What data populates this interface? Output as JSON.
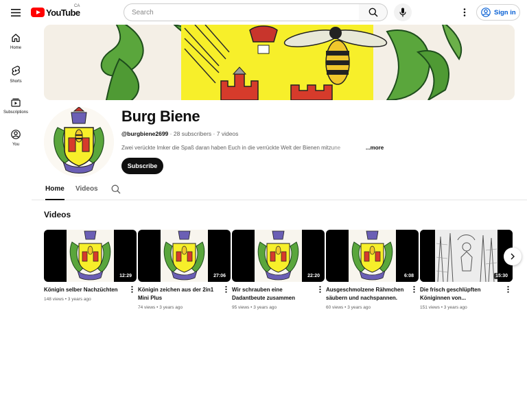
{
  "header": {
    "logo_text": "YouTube",
    "country_code": "CA",
    "search_placeholder": "Search",
    "sign_in_label": "Sign in"
  },
  "sidebar": {
    "items": [
      {
        "label": "Home",
        "icon": "home-icon"
      },
      {
        "label": "Shorts",
        "icon": "shorts-icon"
      },
      {
        "label": "Subscriptions",
        "icon": "subscriptions-icon"
      },
      {
        "label": "You",
        "icon": "you-icon"
      }
    ]
  },
  "channel": {
    "name": "Burg Biene",
    "handle": "@burgbiene2699",
    "subscribers": "28 subscribers",
    "video_count": "7 videos",
    "description": "Zwei verückte Imker die Spaß daran haben Euch in die verrückte Welt der Bienen mitzune",
    "more_label": "...more",
    "subscribe_label": "Subscribe"
  },
  "tabs": [
    {
      "label": "Home",
      "active": true
    },
    {
      "label": "Videos",
      "active": false
    }
  ],
  "section": {
    "title": "Videos"
  },
  "videos": [
    {
      "title": "Königin selber Nachzüchten",
      "duration": "12:29",
      "views": "148 views",
      "age": "3 years ago"
    },
    {
      "title": "Königin zeichen aus der 2in1 Mini Plus",
      "duration": "27:06",
      "views": "74 views",
      "age": "3 years ago"
    },
    {
      "title": "Wir schrauben eine Dadantbeute zusammen",
      "duration": "22:20",
      "views": "95 views",
      "age": "3 years ago"
    },
    {
      "title": "Ausgeschmolzene Rähmchen säubern und nachspannen.",
      "duration": "6:08",
      "views": "60 views",
      "age": "3 years ago"
    },
    {
      "title": "Die frisch geschlüpften Königinnen von...",
      "duration": "15:30",
      "views": "151 views",
      "age": "3 years ago"
    }
  ],
  "colors": {
    "brand_red": "#ff0000",
    "link_blue": "#065fd4",
    "text_primary": "#0f0f0f",
    "text_secondary": "#606060"
  }
}
